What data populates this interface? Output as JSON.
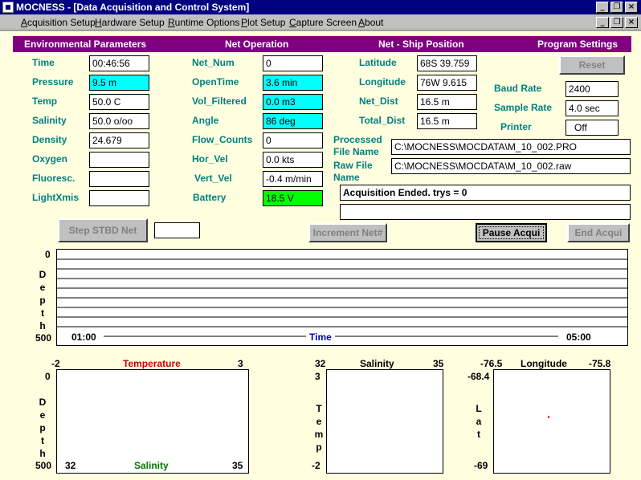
{
  "window": {
    "title": "MOCNESS - [Data Acquisition and Control System]"
  },
  "menu": [
    {
      "key": "A",
      "rest": "cquisition Setup"
    },
    {
      "key": "H",
      "rest": "ardware Setup"
    },
    {
      "key": "R",
      "rest": "untime Options"
    },
    {
      "key": "P",
      "rest": "lot Setup"
    },
    {
      "key": "C",
      "rest": "apture Screen"
    },
    {
      "key": "A",
      "rest": "bout"
    }
  ],
  "window_buttons": {
    "minimize": "_",
    "restore": "❐",
    "close": "×"
  },
  "headers": {
    "env": "Environmental Parameters",
    "net": "Net Operation",
    "pos": "Net - Ship Position",
    "prog": "Program Settings"
  },
  "env": {
    "time_label": "Time",
    "time_value": "00:46:56",
    "pressure_label": "Pressure",
    "pressure_value": "9.5 m",
    "temp_label": "Temp",
    "temp_value": "50.0 C",
    "salinity_label": "Salinity",
    "salinity_value": "50.0 o/oo",
    "density_label": "Density",
    "density_value": "24.679",
    "oxygen_label": "Oxygen",
    "oxygen_value": "",
    "fluoresc_label": "Fluoresc.",
    "fluoresc_value": "",
    "lightxmis_label": "LightXmis",
    "lightxmis_value": ""
  },
  "net": {
    "net_num_label": "Net_Num",
    "net_num_value": "0",
    "opentime_label": "OpenTime",
    "opentime_value": "3.6 min",
    "vol_label": "Vol_Filtered",
    "vol_value": "0.0 m3",
    "angle_label": "Angle",
    "angle_value": "86 deg",
    "flow_label": "Flow_Counts",
    "flow_value": "0",
    "horvel_label": "Hor_Vel",
    "horvel_value": "0.0 kts",
    "vertvel_label": "Vert_Vel",
    "vertvel_value": "-0.4 m/min",
    "battery_label": "Battery",
    "battery_value": "18.5 V"
  },
  "pos": {
    "lat_label": "Latitude",
    "lat_value": "68S 39.759",
    "lon_label": "Longitude",
    "lon_value": "76W 9.615",
    "netdist_label": "Net_Dist",
    "netdist_value": "16.5 m",
    "totaldist_label": "Total_Dist",
    "totaldist_value": "16.5 m"
  },
  "prog": {
    "reset_label": "Reset",
    "baud_label": "Baud Rate",
    "baud_value": "2400",
    "sample_label": "Sample Rate",
    "sample_value": "4.0 sec",
    "printer_label": "Printer",
    "printer_value": "Off"
  },
  "files": {
    "processed_label_1": "Processed",
    "processed_label_2": "File Name",
    "processed_value": "C:\\MOCNESS\\MOCDATA\\M_10_002.PRO",
    "raw_label_1": "Raw File",
    "raw_label_2": "Name",
    "raw_value": "C:\\MOCNESS\\MOCDATA\\M_10_002.raw",
    "status_value": "Acquisition Ended.  trys = 0",
    "status2_value": ""
  },
  "buttons": {
    "step_stbd": "Step STBD Net",
    "step_value": "",
    "increment": "Increment Net#",
    "pause": "Pause Acqui",
    "end": "End Acqui"
  },
  "depth_plot": {
    "y_top": "0",
    "y_bottom": "500",
    "y_label": [
      "D",
      "e",
      "p",
      "t",
      "h"
    ],
    "x_start": "01:00",
    "x_end": "05:00",
    "x_label": "Time"
  },
  "temp_plot": {
    "x_min": "-2",
    "x_max": "3",
    "title": "Temperature",
    "y_top": "0",
    "y_bottom": "500",
    "y_label": [
      "D",
      "e",
      "p",
      "t",
      "h"
    ],
    "sal_min": "32",
    "sal_max": "35",
    "sal_label": "Salinity"
  },
  "sal_plot": {
    "x_min": "32",
    "x_max": "35",
    "title": "Salinity",
    "y_top": "3",
    "y_bottom": "-2",
    "y_label": [
      "T",
      "e",
      "m",
      "p"
    ]
  },
  "lon_plot": {
    "x_min": "-76.5",
    "x_max": "-75.8",
    "title": "Longitude",
    "y_top": "-68.4",
    "y_bottom": "-69",
    "y_label": [
      "L",
      "a",
      "t"
    ]
  },
  "colors": {
    "title_bar": "#000080",
    "header_band": "#800080",
    "label_teal": "#008080",
    "highlight_cyan": "#00ffff",
    "battery_green": "#00ff00",
    "temperature_red": "#cc0000",
    "salinity_green": "#007700",
    "time_blue": "#0000aa",
    "position_dot": "#ff0000"
  }
}
